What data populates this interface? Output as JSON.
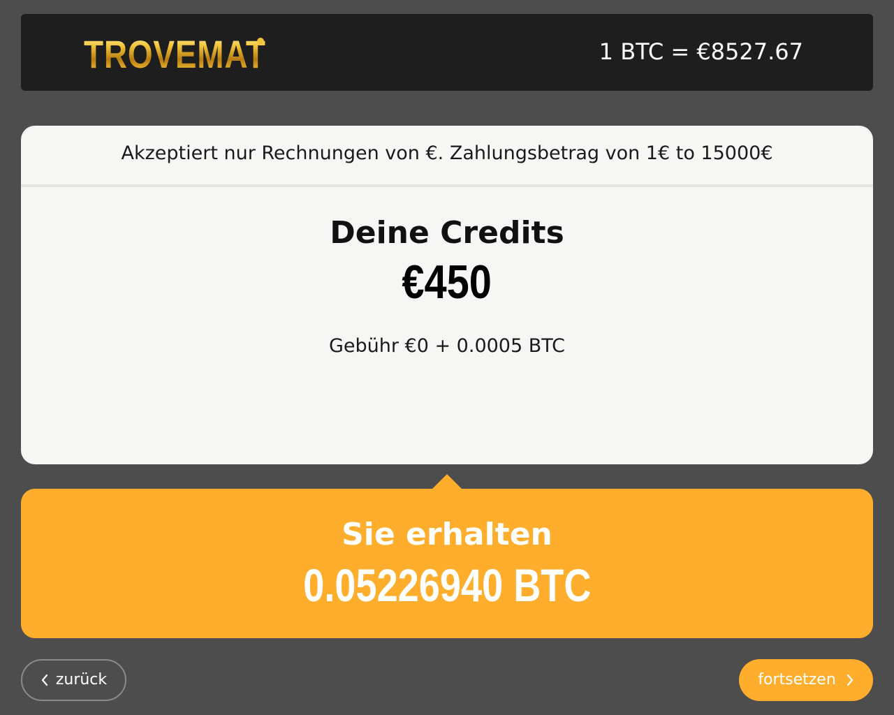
{
  "header": {
    "logo_text": "TROVEMAT",
    "exchange_rate": "1 BTC = €8527.67"
  },
  "card": {
    "notice": "Akzeptiert nur Rechnungen von €. Zahlungsbetrag von 1€ to 15000€",
    "credits_title": "Deine Credits",
    "credits_value": "€450",
    "fee": "Gebühr €0 + 0.0005 BTC"
  },
  "receive": {
    "title": "Sie erhalten",
    "value": "0.05226940 BTC"
  },
  "footer": {
    "back_label": "zurück",
    "back_icon": "chevron-left-icon",
    "next_label": "fortsetzen",
    "next_icon": "chevron-right-icon"
  },
  "colors": {
    "background": "#4d4d4d",
    "header": "#1e1e1e",
    "card": "#f6f6f4",
    "accent": "#feae2c",
    "logo_gold": "#f2c43a"
  }
}
